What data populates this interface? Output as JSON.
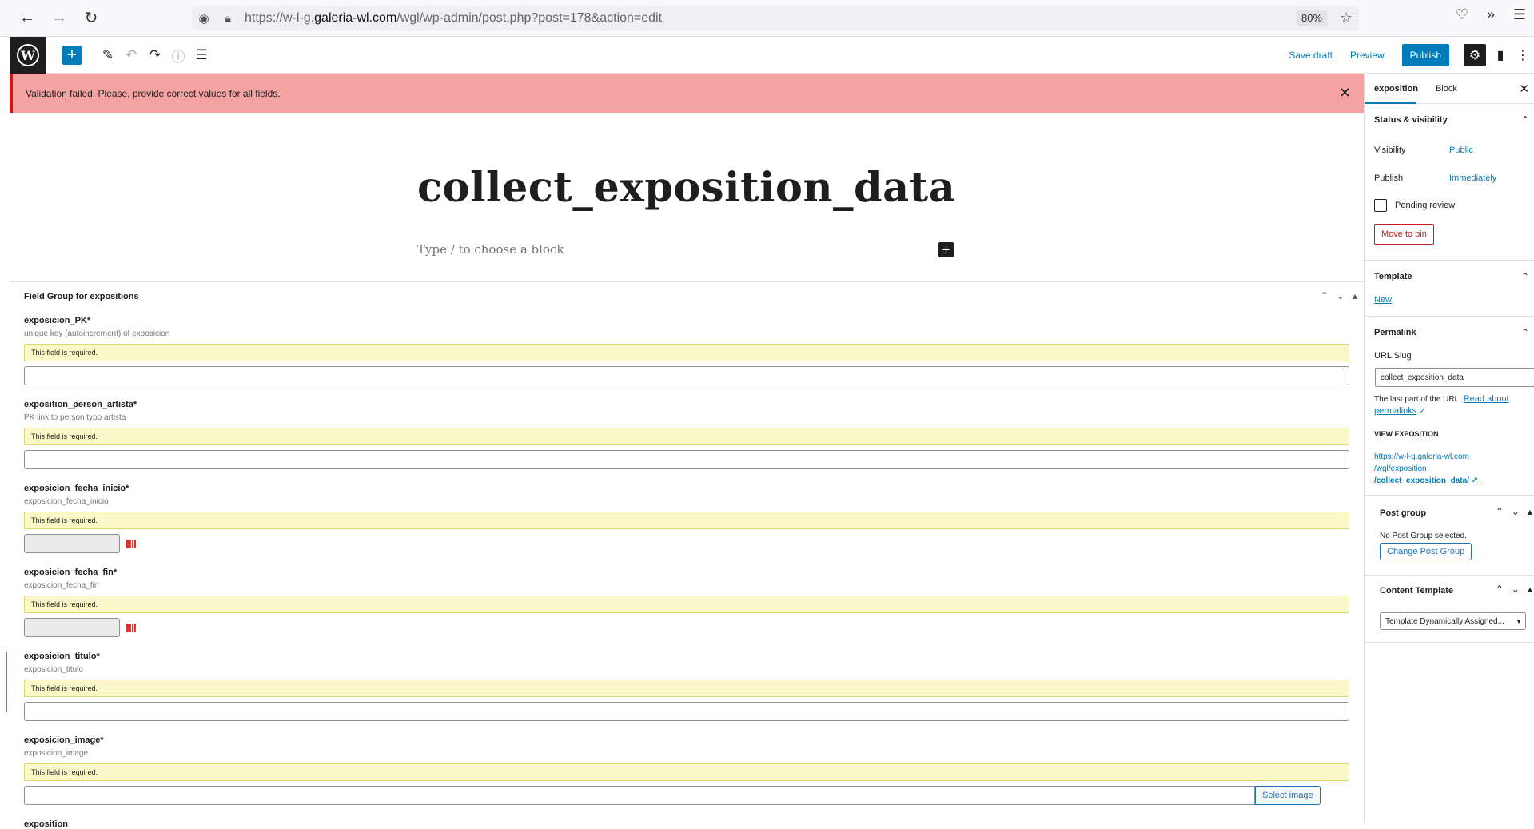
{
  "browser": {
    "url_prefix": "https://w-l-g.",
    "url_domain": "galeria-wl.com",
    "url_path": "/wgl/wp-admin/post.php?post=178&action=edit",
    "zoom": "80%"
  },
  "toolbar": {
    "save_draft": "Save draft",
    "preview": "Preview",
    "publish": "Publish"
  },
  "notice": {
    "text": "Validation failed. Please, provide correct values for all fields."
  },
  "editor": {
    "title": "collect_exposition_data",
    "placeholder": "Type / to choose a block"
  },
  "metabox": {
    "title": "Field Group for expositions",
    "error_text": "This field is required.",
    "fields": [
      {
        "label": "exposicion_PK*",
        "desc": "unique key (autoincrement) of exposicion"
      },
      {
        "label": "exposition_person_artista*",
        "desc": "PK link to person typo artista"
      },
      {
        "label": "exposicion_fecha_inicio*",
        "desc": "exposicion_fecha_inicio"
      },
      {
        "label": "exposicion_fecha_fin*",
        "desc": "exposicion_fecha_fin"
      },
      {
        "label": "exposicion_titulo*",
        "desc": "exposicion_titulo"
      },
      {
        "label": "exposicion_image*",
        "desc": "exposicion_image"
      }
    ],
    "select_image": "Select image",
    "next_label": "exposition"
  },
  "sidebar": {
    "tabs": [
      "exposition",
      "Block"
    ],
    "status_title": "Status & visibility",
    "visibility_label": "Visibility",
    "visibility_value": "Public",
    "publish_label": "Publish",
    "publish_value": "Immediately",
    "pending_review": "Pending review",
    "move_to_bin": "Move to bin",
    "template_title": "Template",
    "template_new": "New",
    "permalink_title": "Permalink",
    "url_slug_label": "URL Slug",
    "url_slug_value": "collect_exposition_data",
    "permalink_help": "The last part of the URL.",
    "permalink_link": "Read about permalinks",
    "view_title": "VIEW EXPOSITION",
    "view_url_1": "https://w-l-g.galeria-wl.com",
    "view_url_2": "/wgl/exposition",
    "view_url_3": "/collect_exposition_data/",
    "post_group_title": "Post group",
    "post_group_none": "No Post Group selected.",
    "change_post_group": "Change Post Group",
    "content_template_title": "Content Template",
    "content_template_value": "Template Dynamically Assigned..."
  }
}
